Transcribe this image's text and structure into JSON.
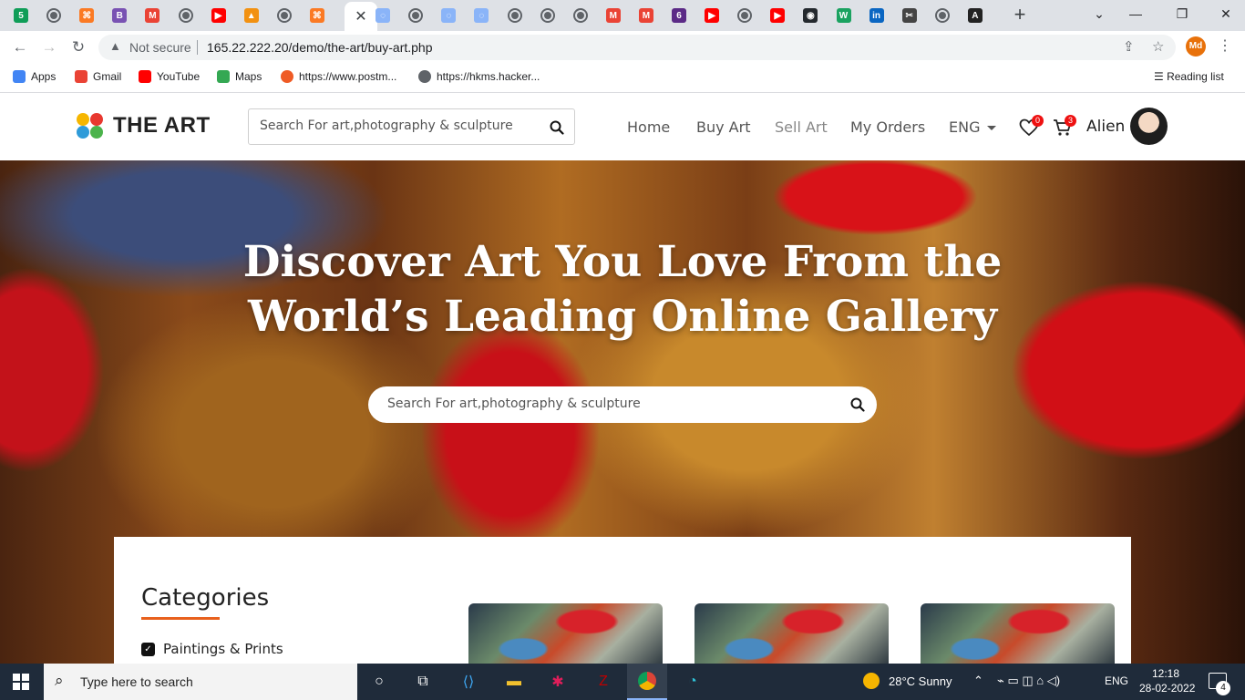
{
  "browser": {
    "tabs": [
      {
        "icon": "five-badge-icon",
        "color": "#0f9d58",
        "glyph": "5"
      },
      {
        "icon": "globe-icon"
      },
      {
        "icon": "xampp-icon",
        "color": "#fb7a24",
        "glyph": "⌘"
      },
      {
        "icon": "bootstrap-icon",
        "color": "#7952b3",
        "glyph": "B"
      },
      {
        "icon": "gmail-icon",
        "color": "#ea4335",
        "glyph": "M"
      },
      {
        "icon": "globe-icon"
      },
      {
        "icon": "youtube-icon",
        "color": "#ff0000",
        "glyph": "▶"
      },
      {
        "icon": "pma-icon",
        "color": "#f29111",
        "glyph": "▲"
      },
      {
        "icon": "globe-icon"
      },
      {
        "icon": "xampp-icon",
        "color": "#fb7a24",
        "glyph": "⌘"
      },
      {
        "icon": "close-icon",
        "active": true
      },
      {
        "icon": "loading-icon",
        "color": "#8ab4f8",
        "glyph": "◌"
      },
      {
        "icon": "globe-icon"
      },
      {
        "icon": "loading-icon",
        "color": "#8ab4f8",
        "glyph": "◌"
      },
      {
        "icon": "loading-icon",
        "color": "#8ab4f8",
        "glyph": "◌"
      },
      {
        "icon": "globe-icon"
      },
      {
        "icon": "globe-icon"
      },
      {
        "icon": "globe-icon"
      },
      {
        "icon": "gmail-icon",
        "color": "#ea4335",
        "glyph": "M"
      },
      {
        "icon": "gmail-icon",
        "color": "#ea4335",
        "glyph": "M"
      },
      {
        "icon": "six-icon",
        "color": "#5b2a86",
        "glyph": "6"
      },
      {
        "icon": "youtube-icon",
        "color": "#ff0000",
        "glyph": "▶"
      },
      {
        "icon": "globe-icon"
      },
      {
        "icon": "youtube-icon",
        "color": "#ff0000",
        "glyph": "▶"
      },
      {
        "icon": "github-icon",
        "color": "#24292e",
        "glyph": "◉"
      },
      {
        "icon": "w-icon",
        "color": "#1aa260",
        "glyph": "W"
      },
      {
        "icon": "linkedin-icon",
        "color": "#0a66c2",
        "glyph": "in"
      },
      {
        "icon": "scissors-icon",
        "color": "#444",
        "glyph": "✂"
      },
      {
        "icon": "globe-icon"
      },
      {
        "icon": "angular-icon",
        "color": "#222",
        "glyph": "A"
      }
    ],
    "not_secure": "Not secure",
    "url": "165.22.222.20/demo/the-art/buy-art.php",
    "profile_initials": "Md",
    "bookmarks": [
      {
        "label": "Apps",
        "icon": "apps-grid-icon",
        "color": "#4285f4"
      },
      {
        "label": "Gmail",
        "icon": "gmail-icon",
        "color": "#ea4335"
      },
      {
        "label": "YouTube",
        "icon": "youtube-icon",
        "color": "#ff0000"
      },
      {
        "label": "Maps",
        "icon": "maps-icon",
        "color": "#34a853"
      },
      {
        "label": "https://www.postm...",
        "icon": "postman-icon",
        "color": "#ef5b25"
      },
      {
        "label": "https://hkms.hacker...",
        "icon": "globe-icon",
        "color": "#5f6368"
      }
    ],
    "reading_list": "Reading list"
  },
  "site": {
    "logo_text": "THE ART",
    "logo_colors": [
      "#f6b600",
      "#e8382f",
      "#2e9bd9",
      "#4bb34b"
    ],
    "search_placeholder": "Search For art,photography & sculpture",
    "nav": {
      "home": "Home",
      "buy_art": "Buy Art",
      "sell_art": "Sell Art",
      "my_orders": "My Orders",
      "language": "ENG"
    },
    "wishlist_count": "0",
    "cart_count": "3",
    "username": "Alien"
  },
  "hero": {
    "title_line1": "Discover Art You Love From the",
    "title_line2": "World’s Leading Online Gallery",
    "search_placeholder": "Search For art,photography & sculpture"
  },
  "categories": {
    "title": "Categories",
    "items": [
      {
        "label": "Paintings & Prints",
        "checked": true
      }
    ],
    "accent": "#e8601c"
  },
  "taskbar": {
    "search_text": "Type here to search",
    "weather": "28°C  Sunny",
    "language": "ENG",
    "time": "12:18",
    "date": "28-02-2022",
    "notifications": "4"
  }
}
